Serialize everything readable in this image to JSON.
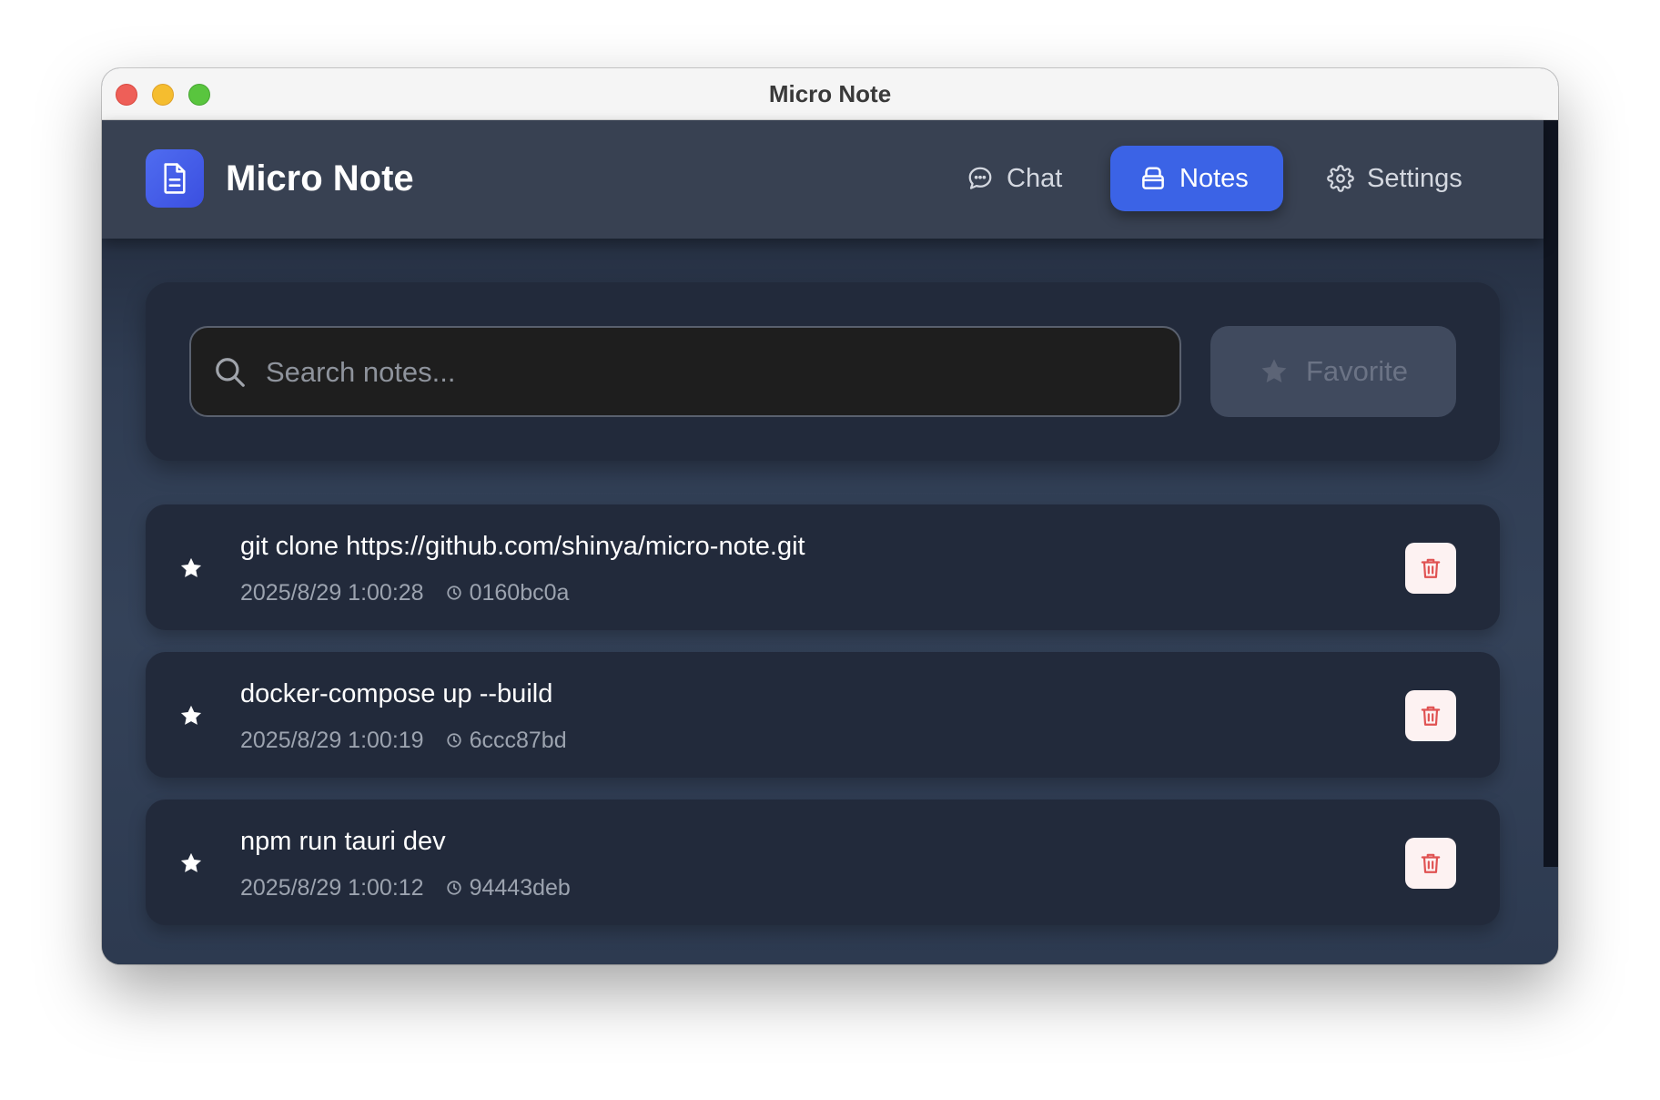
{
  "window": {
    "title": "Micro Note"
  },
  "header": {
    "brand": "Micro Note",
    "logo_icon": "document-icon",
    "nav": {
      "chat": {
        "label": "Chat",
        "icon": "chat-bubble-icon"
      },
      "notes": {
        "label": "Notes",
        "icon": "archive-icon",
        "active": true
      },
      "settings": {
        "label": "Settings",
        "icon": "gear-icon"
      }
    }
  },
  "search": {
    "placeholder": "Search notes...",
    "value": "",
    "icon": "search-icon",
    "favorite_label": "Favorite",
    "favorite_icon": "star-icon"
  },
  "notes": [
    {
      "text": "git clone https://github.com/shinya/micro-note.git",
      "date": "2025/8/29 1:00:28",
      "hash": "0160bc0a"
    },
    {
      "text": "docker-compose up --build",
      "date": "2025/8/29 1:00:19",
      "hash": "6ccc87bd"
    },
    {
      "text": "npm run tauri dev",
      "date": "2025/8/29 1:00:12",
      "hash": "94443deb"
    }
  ],
  "colors": {
    "accent": "#3b63e6",
    "card": "#222a3b",
    "header": "#384152",
    "delete": "#e05252"
  }
}
